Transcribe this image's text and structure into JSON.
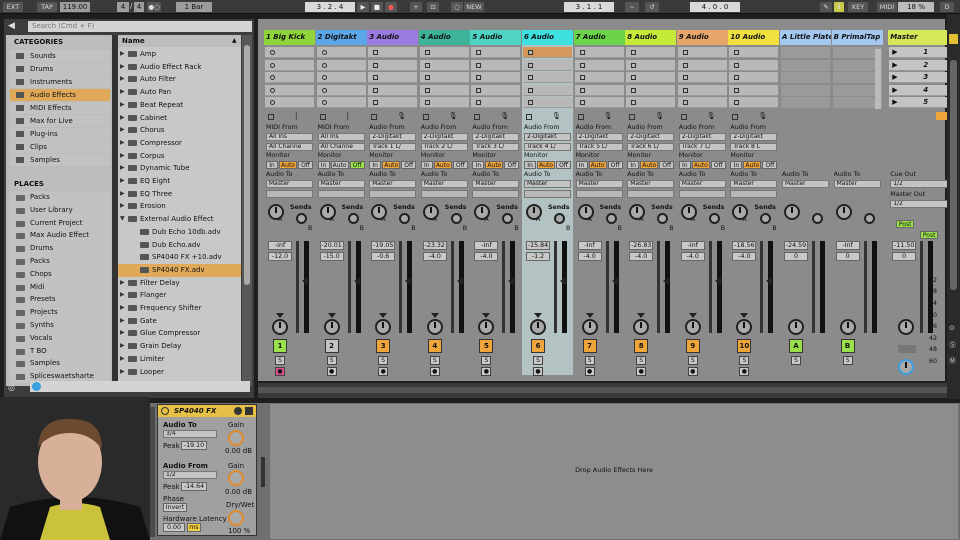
{
  "transport": {
    "ext": "EXT",
    "tap": "TAP",
    "tempo": "119.00",
    "sig_num": "4",
    "sig_den": "4",
    "quant": "1 Bar",
    "position": "3 . 2 . 4",
    "new_label": "NEW",
    "loop_start": "3 . 1 . 1",
    "loop_len": "4 . 0 . 0",
    "key": "KEY",
    "midi": "MIDI",
    "cpu": "18 %",
    "d": "D"
  },
  "browser": {
    "search_placeholder": "Search (Cmd + F)",
    "categories_title": "CATEGORIES",
    "categories": [
      "Sounds",
      "Drums",
      "Instruments",
      "Audio Effects",
      "MIDI Effects",
      "Max for Live",
      "Plug-ins",
      "Clips",
      "Samples"
    ],
    "places_title": "PLACES",
    "places": [
      "Packs",
      "User Library",
      "Current Project",
      "Max Audio Effect",
      "Drums",
      "Packs",
      "Chops",
      "Midi",
      "Presets",
      "Projects",
      "Synths",
      "Vocals",
      "T BO",
      "Samples",
      "Spliceswaetsharte"
    ],
    "name_header": "Name",
    "items": [
      "Amp",
      "Audio Effect Rack",
      "Auto Filter",
      "Auto Pan",
      "Beat Repeat",
      "Cabinet",
      "Chorus",
      "Compressor",
      "Corpus",
      "Dynamic Tube",
      "EQ Eight",
      "EQ Three",
      "Erosion",
      "External Audio Effect",
      "Dub Echo 10db.adv",
      "Dub Echo.adv",
      "SP4040 FX +10.adv",
      "SP4040 FX.adv",
      "Filter Delay",
      "Flanger",
      "Frequency Shifter",
      "Gate",
      "Glue Compressor",
      "Grain Delay",
      "Limiter",
      "Looper"
    ]
  },
  "tracks": [
    {
      "name": "1 Big Kick",
      "color": "#8fd43a",
      "from_label": "MIDI From",
      "from": "All Ins",
      "from_ch": "All Channe",
      "mon": "Auto",
      "to": "Master",
      "vol": "-Inf",
      "pan": "-12.0",
      "num": "1",
      "numcolor": "#9ae04a"
    },
    {
      "name": "2 Digitakt",
      "color": "#5aa6e6",
      "from_label": "MIDI From",
      "from": "All Ins",
      "from_ch": "All Channe",
      "mon": "Off",
      "to": "Master",
      "vol": "-20.01",
      "pan": "-15.0",
      "num": "2",
      "numcolor": "#c4c4c4"
    },
    {
      "name": "3 Audio",
      "color": "#9b7be0",
      "from_label": "Audio From",
      "from": "2-Digitakt",
      "from_ch": "Track 1 L/",
      "mon": "Auto",
      "to": "Master",
      "vol": "-19.05",
      "pan": "-0.6",
      "num": "3",
      "numcolor": "#f0a53a"
    },
    {
      "name": "4 Audio",
      "color": "#3fb39a",
      "from_label": "Audio From",
      "from": "2-Digitakt",
      "from_ch": "Track 2 L/",
      "mon": "Auto",
      "to": "Master",
      "vol": "-23.32",
      "pan": "-4.0",
      "num": "4",
      "numcolor": "#f0a53a"
    },
    {
      "name": "5 Audio",
      "color": "#4fd4c4",
      "from_label": "Audio From",
      "from": "2-Digitakt",
      "from_ch": "Track 3 L/",
      "mon": "Auto",
      "to": "Master",
      "vol": "-Inf",
      "pan": "-4.0",
      "num": "5",
      "numcolor": "#f0a53a"
    },
    {
      "name": "6 Audio",
      "color": "#3ee0e0",
      "from_label": "Audio From",
      "from": "2-Digitakt",
      "from_ch": "Track 4 L/",
      "mon": "Auto",
      "to": "Master",
      "vol": "-15.84",
      "pan": "-1.2",
      "num": "6",
      "numcolor": "#f0a53a"
    },
    {
      "name": "7 Audio",
      "color": "#6cd44a",
      "from_label": "Audio From",
      "from": "2-Digitakt",
      "from_ch": "Track 5 L/",
      "mon": "Auto",
      "to": "Master",
      "vol": "-Inf",
      "pan": "-4.0",
      "num": "7",
      "numcolor": "#f0a53a"
    },
    {
      "name": "8 Audio",
      "color": "#c6ea3a",
      "from_label": "Audio From",
      "from": "2-Digitakt",
      "from_ch": "Track 6 L/",
      "mon": "Auto",
      "to": "Master",
      "vol": "-26.83",
      "pan": "-4.0",
      "num": "8",
      "numcolor": "#f0a53a"
    },
    {
      "name": "9 Audio",
      "color": "#e6a66a",
      "from_label": "Audio From",
      "from": "2-Digitakt",
      "from_ch": "Track 7 L/",
      "mon": "Auto",
      "to": "Master",
      "vol": "-Inf",
      "pan": "-4.0",
      "num": "9",
      "numcolor": "#f0a53a"
    },
    {
      "name": "10 Audio",
      "color": "#f0e040",
      "from_label": "Audio From",
      "from": "2-Digitakt",
      "from_ch": "Track 8 L",
      "mon": "Auto",
      "to": "Master",
      "vol": "-18.56",
      "pan": "-4.0",
      "num": "10",
      "numcolor": "#f0a53a"
    }
  ],
  "returns": [
    {
      "name": "A Little Plate",
      "color": "#a5c8f0",
      "to": "Master",
      "vol": "-24.59",
      "pan": "0",
      "num": "A",
      "to_label": "Audio To"
    },
    {
      "name": "B PrimalTap",
      "color": "#a5c8f0",
      "to": "Master",
      "vol": "-Inf",
      "pan": "0",
      "num": "B",
      "to_label": "Audio To"
    }
  ],
  "master": {
    "name": "Master",
    "scenes": [
      "1",
      "2",
      "3",
      "4",
      "5"
    ],
    "cue_out_label": "Cue Out",
    "cue_out": "1/2",
    "master_out_label": "Master Out",
    "master_out": "1/2",
    "vol": "-11.50",
    "pan": "0",
    "post": "Post",
    "scale": [
      "6",
      "0",
      "6",
      "12",
      "18",
      "24",
      "30",
      "36",
      "42",
      "48",
      "60"
    ]
  },
  "labels": {
    "monitor": "Monitor",
    "in": "In",
    "auto": "Auto",
    "off": "Off",
    "audio_to": "Audio To",
    "sends": "Sends",
    "a": "A",
    "b": "B",
    "s": "S"
  },
  "device": {
    "title": "SP4040 FX",
    "audio_to_label": "Audio To",
    "audio_to": "3/4",
    "gain_label": "Gain",
    "gain1": "0.00 dB",
    "peak_label": "Peak",
    "peak1": "-19.10",
    "audio_from_label": "Audio From",
    "audio_from": "1/2",
    "gain2": "0.00 dB",
    "peak2": "-14.64",
    "phase_label": "Phase",
    "invert": "Invert",
    "latency_label": "Hardware Latency",
    "latency": "0.00",
    "ms": "ms",
    "drywet_label": "Dry/Wet",
    "drywet": "100 %"
  },
  "drop_text": "Drop Audio Effects Here"
}
